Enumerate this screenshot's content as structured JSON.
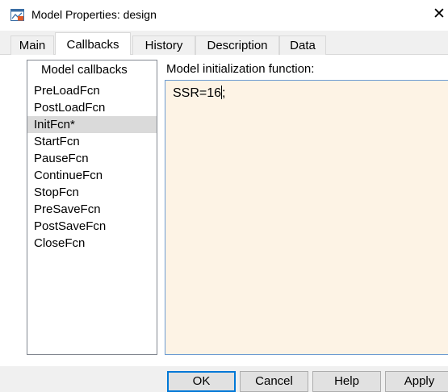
{
  "window": {
    "title": "Model Properties: design",
    "close_glyph": "✕",
    "icon": "simulink-model-icon"
  },
  "tabs": [
    {
      "label": "Main",
      "active": false
    },
    {
      "label": "Callbacks",
      "active": true
    },
    {
      "label": "History",
      "active": false
    },
    {
      "label": "Description",
      "active": false
    },
    {
      "label": "Data",
      "active": false
    }
  ],
  "callbacks": {
    "heading": "Model callbacks",
    "items": [
      "PreLoadFcn",
      "PostLoadFcn",
      "InitFcn*",
      "StartFcn",
      "PauseFcn",
      "ContinueFcn",
      "StopFcn",
      "PreSaveFcn",
      "PostSaveFcn",
      "CloseFcn"
    ],
    "selected_index": 2
  },
  "editor": {
    "label": "Model initialization function:",
    "text_before_caret": "SSR=16",
    "text_after_caret": ";",
    "background": "#fdf3e5"
  },
  "buttons": {
    "ok": "OK",
    "cancel": "Cancel",
    "help": "Help",
    "apply": "Apply"
  }
}
